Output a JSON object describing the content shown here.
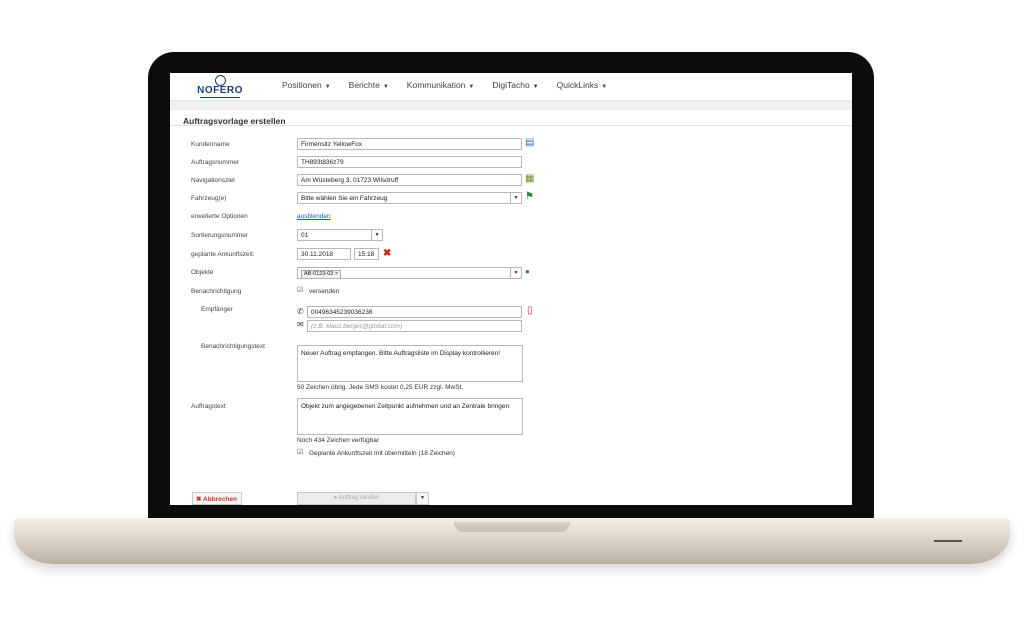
{
  "nav": {
    "logo_text": "NOFERO",
    "items": [
      {
        "label": "Positionen"
      },
      {
        "label": "Berichte"
      },
      {
        "label": "Kommunikation"
      },
      {
        "label": "DigiTacho"
      },
      {
        "label": "QuickLinks"
      }
    ]
  },
  "panel": {
    "title": "Auftragsvorlage erstellen"
  },
  "form": {
    "kundenname": {
      "label": "Kundenname",
      "value": "Firmensitz YellowFox"
    },
    "auftragsnummer": {
      "label": "Auftragsnummer",
      "value": "TH893t836z79"
    },
    "navigationsziel": {
      "label": "Navigationsziel",
      "value": "Am Wüsteberg 3, 01723 Wilsdruff"
    },
    "fahrzeug": {
      "label": "Fahrzeug(e)",
      "value": "Bitte wählen Sie ein Fahrzeug"
    },
    "erweiterte": {
      "label": "erweiterte Optionen",
      "link": "ausblenden"
    },
    "sortierung": {
      "label": "Sortierungsnummer",
      "value": "01"
    },
    "ankunft": {
      "label": "geplante Ankunftszeit:",
      "date": "30.11.2018",
      "time": "15:18"
    },
    "objekte": {
      "label": "Objekte",
      "tag": "AB-0123-03 ×"
    },
    "benachrichtigung": {
      "label": "Benachrichtigung",
      "checkbox_label": "versenden"
    },
    "empfaenger": {
      "label": "Empfänger",
      "phone": "00496345239036236",
      "email_placeholder": "(z.B. klaus.berger@global.com)"
    },
    "benachrichtigungstext": {
      "label": "Benachrichtigungstext",
      "value": "Neuer Auftrag empfangen. Bitte Auftragsliste im Display kontrollieren!",
      "info": "50 Zeichen übrig. Jede SMS kostet 0,25 EUR zzgl. MwSt."
    },
    "auftragstext": {
      "label": "Auftragstext",
      "value": "Objekt zum angegebenen Zeitpunkt aufnehmen und an Zentrale bringen",
      "info": "Noch 434 Zeichen verfügbar",
      "checkbox_label": "Geplante Ankunftszeit mit übermitteln (18 Zeichen)"
    }
  },
  "buttons": {
    "cancel": "Abbrechen",
    "save": "Auftrag senden"
  },
  "colors": {
    "brand": "#1e3f77",
    "link": "#1a5fb4",
    "cancel": "#c0392b"
  }
}
